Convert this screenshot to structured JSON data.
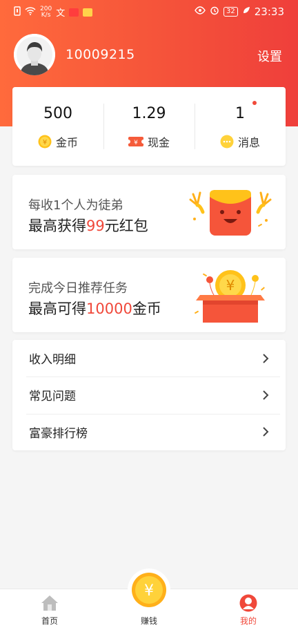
{
  "status_bar": {
    "net_speed": "200",
    "net_unit": "K/s",
    "battery": "32",
    "time": "23:33"
  },
  "profile": {
    "user_id": "10009215",
    "settings_label": "设置"
  },
  "stats": [
    {
      "value": "500",
      "label": "金币",
      "icon": "coin-icon"
    },
    {
      "value": "1.29",
      "label": "现金",
      "icon": "cash-ticket-icon"
    },
    {
      "value": "1",
      "label": "消息",
      "icon": "message-bubble-icon"
    }
  ],
  "promos": [
    {
      "line1": "每收1个人为徒弟",
      "line2_prefix": "最高获得",
      "line2_highlight": "99",
      "line2_suffix": "元红包",
      "art": "red-envelope-mascot"
    },
    {
      "line1": "完成今日推荐任务",
      "line2_prefix": "最高可得",
      "line2_highlight": "10000",
      "line2_suffix": "金币",
      "art": "gift-box-coin"
    }
  ],
  "menu": [
    {
      "label": "收入明细"
    },
    {
      "label": "常见问题"
    },
    {
      "label": "富豪排行榜"
    }
  ],
  "tabs": {
    "home": "首页",
    "earn": "赚钱",
    "me": "我的"
  },
  "colors": {
    "brand": "#f0483a",
    "header_gradient_start": "#ff6a3c",
    "header_gradient_end": "#ef3f3b",
    "coin": "#ffc21a"
  }
}
